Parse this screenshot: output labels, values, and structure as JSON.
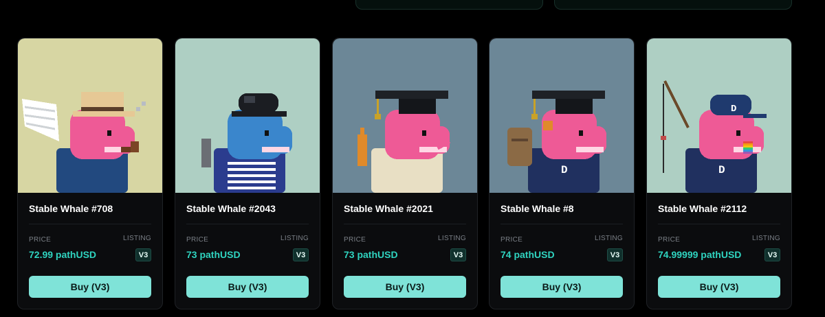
{
  "cards": [
    {
      "name": "Stable Whale #708",
      "price_label": "PRICE",
      "listing_label": "LISTING",
      "price": "72.99 pathUSD",
      "version": "V3",
      "buy_label": "Buy (V3)",
      "bg": "#d7d6a3",
      "body": "#ee5a96",
      "outfit": "#22497f",
      "hat": "straw-hat",
      "accessory": "wings-pipe"
    },
    {
      "name": "Stable Whale #2043",
      "price_label": "PRICE",
      "listing_label": "LISTING",
      "price": "73 pathUSD",
      "version": "V3",
      "buy_label": "Buy (V3)",
      "bg": "#aecfc3",
      "body": "#3a86cc",
      "outfit": "#2b3c8e",
      "hat": "bowler-hat",
      "accessory": "striped-shirt"
    },
    {
      "name": "Stable Whale #2021",
      "price_label": "PRICE",
      "listing_label": "LISTING",
      "price": "73 pathUSD",
      "version": "V3",
      "buy_label": "Buy (V3)",
      "bg": "#6c8797",
      "body": "#ee5a96",
      "outfit": "#e8dfc4",
      "hat": "grad-cap",
      "accessory": "tan-sweater"
    },
    {
      "name": "Stable Whale #8",
      "price_label": "PRICE",
      "listing_label": "LISTING",
      "price": "74 pathUSD",
      "version": "V3",
      "buy_label": "Buy (V3)",
      "bg": "#6c8797",
      "body": "#ee5a96",
      "outfit": "#20305f",
      "hat": "grad-cap",
      "accessory": "backpack-hoodie"
    },
    {
      "name": "Stable Whale #2112",
      "price_label": "PRICE",
      "listing_label": "LISTING",
      "price": "74.99999 pathUSD",
      "version": "V3",
      "buy_label": "Buy (V3)",
      "bg": "#aecfc3",
      "body": "#ee5a96",
      "outfit": "#20305f",
      "hat": "d-cap",
      "accessory": "fishing-rod"
    }
  ],
  "colors": {
    "accent": "#2fd4c0",
    "button": "#7fe3d8",
    "card_bg": "#0b0c0e"
  }
}
